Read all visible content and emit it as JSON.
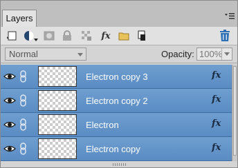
{
  "panel": {
    "tab_label": "Layers",
    "menu_icon": "panel-menu-icon"
  },
  "toolbar": {
    "icons": [
      "new-layer-icon",
      "new-fill-adjustment-layer-icon",
      "add-layer-mask-icon",
      "lock-all-icon",
      "lock-transparency-icon",
      "fx-effects-icon",
      "new-group-folder-icon",
      "link-layers-icon",
      "delete-layer-icon"
    ],
    "fx_label": "fx"
  },
  "options": {
    "blend_mode": "Normal",
    "opacity_label": "Opacity:",
    "opacity_value": "100%"
  },
  "layers": [
    {
      "name": "Electron copy 3",
      "fx": "fx"
    },
    {
      "name": "Electron copy 2",
      "fx": "fx"
    },
    {
      "name": "Electron",
      "fx": "fx"
    },
    {
      "name": "Electron copy",
      "fx": "fx"
    }
  ],
  "colors": {
    "selected_row": "#6596cb",
    "row_border": "#3f6c9e",
    "panel_bg": "#d4d4d4",
    "delete_icon": "#2c6fb3"
  }
}
